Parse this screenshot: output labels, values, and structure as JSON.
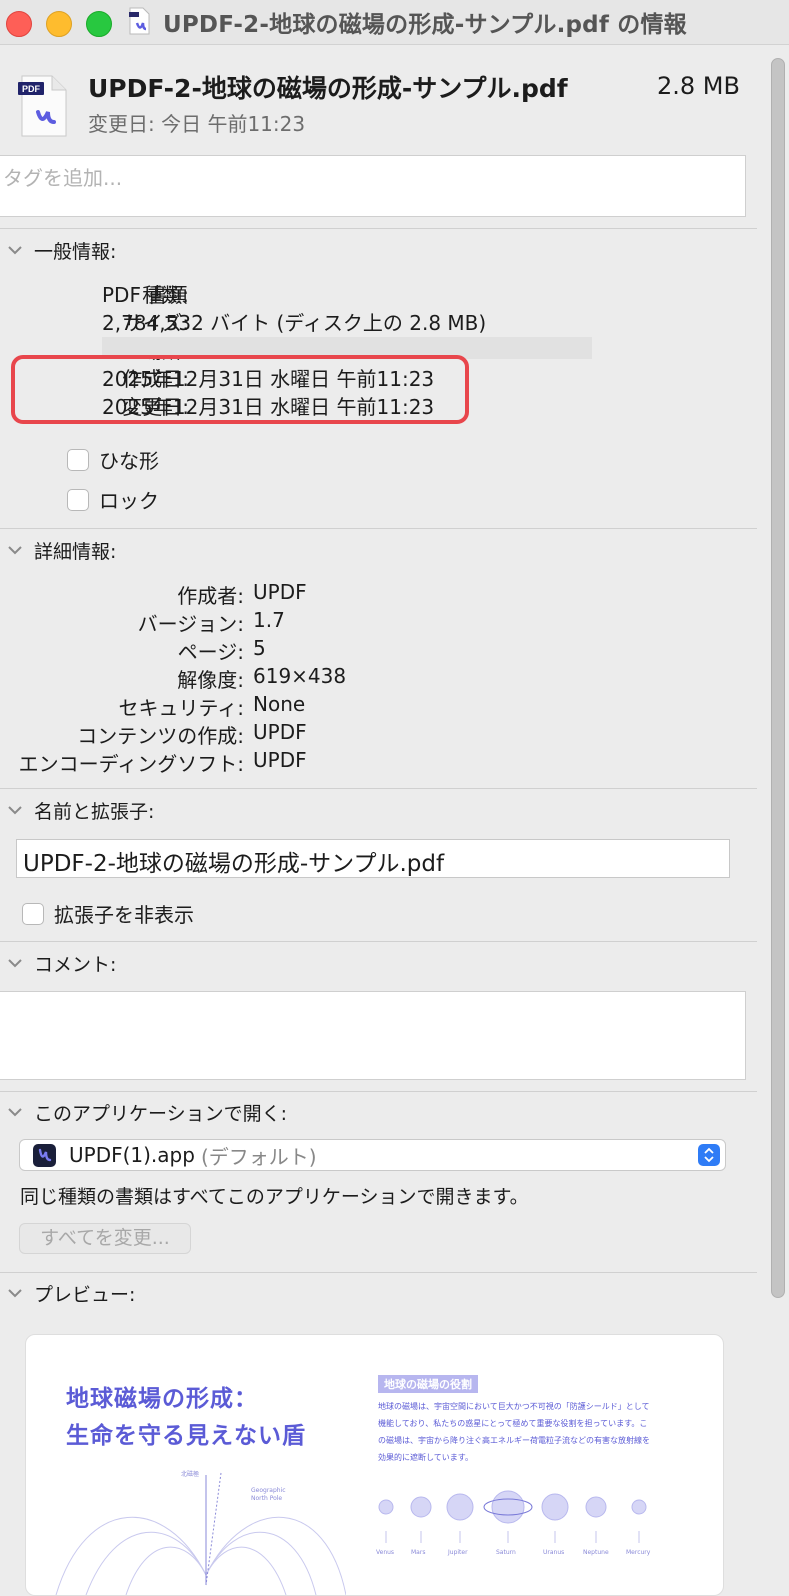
{
  "window": {
    "title": "UPDF-2-地球の磁場の形成-サンプル.pdf の情報"
  },
  "header": {
    "file_name": "UPDF-2-地球の磁場の形成-サンプル.pdf",
    "file_size": "2.8 MB",
    "modified": "変更日: 今日 午前11:23",
    "icon_badge": "PDF"
  },
  "tags": {
    "placeholder": "タグを追加..."
  },
  "general": {
    "title": "一般情報:",
    "rows": [
      {
        "label": "種類:",
        "value": "PDF 書類"
      },
      {
        "label": "サイズ:",
        "value": "2,784,532 バイト (ディスク上の 2.8 MB)"
      },
      {
        "label": "場所:",
        "value": ""
      },
      {
        "label": "作成日:",
        "value": "2025年12月31日 水曜日 午前11:23"
      },
      {
        "label": "変更日:",
        "value": "2025年12月31日 水曜日 午前11:23"
      }
    ],
    "stationery_label": "ひな形",
    "locked_label": "ロック"
  },
  "details": {
    "title": "詳細情報:",
    "rows": [
      {
        "label": "作成者:",
        "value": "UPDF"
      },
      {
        "label": "バージョン:",
        "value": "1.7"
      },
      {
        "label": "ページ:",
        "value": "5"
      },
      {
        "label": "解像度:",
        "value": "619×438"
      },
      {
        "label": "セキュリティ:",
        "value": "None"
      },
      {
        "label": "コンテンツの作成:",
        "value": "UPDF"
      },
      {
        "label": "エンコーディングソフト:",
        "value": "UPDF"
      }
    ]
  },
  "name_ext": {
    "title": "名前と拡張子:",
    "value": "UPDF-2-地球の磁場の形成-サンプル.pdf",
    "hide_ext_label": "拡張子を非表示"
  },
  "comments": {
    "title": "コメント:",
    "value": ""
  },
  "open_with": {
    "title": "このアプリケーションで開く:",
    "app_name": "UPDF(1).app",
    "app_default": "(デフォルト)",
    "note": "同じ種類の書類はすべてこのアプリケーションで開きます。",
    "change_all": "すべてを変更..."
  },
  "preview": {
    "title": "プレビュー:",
    "doc_title_line1": "地球磁場の形成：",
    "doc_title_line2": "生命を守る見えない盾",
    "badge": "地球の磁場の役割",
    "text_lines": [
      "地球の磁場は、宇宙空間において巨大かつ不可視の「防護シールド」として",
      "機能しており、私たちの惑星にとって極めて重要な役割を担っています。こ",
      "の磁場は、宇宙から降り注ぐ高エネルギー荷電粒子流などの有害な放射線を",
      "効果的に遮断しています。"
    ],
    "north_label": "北磁極",
    "geo_label_1": "Geographic",
    "geo_label_2": "North Pole",
    "planets": [
      "Venus",
      "Mars",
      "Jupiter",
      "Saturn",
      "Uranus",
      "Neptune",
      "Mercury"
    ]
  },
  "colors": {
    "highlight": "#e8464c",
    "accent": "#2f7cf6",
    "preview_purple": "#5b5bd6"
  }
}
